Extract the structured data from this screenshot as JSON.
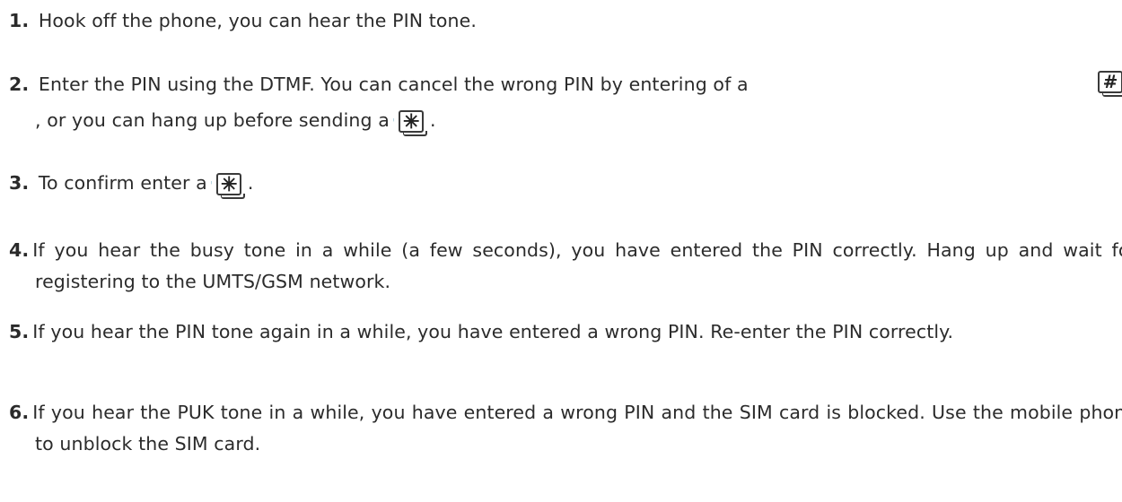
{
  "steps": [
    {
      "num": "1.",
      "text": "Hook off the phone, you can hear the PIN tone."
    },
    {
      "num": "2.",
      "text_a": "Enter the PIN using the DTMF. You can cancel the wrong PIN by entering of a",
      "key_a": "#",
      "text_b": ", or you can hang up before sending a",
      "key_b": "✳",
      "text_c": "."
    },
    {
      "num": "3.",
      "text": "To confirm enter a",
      "key": "✳",
      "text_end": "."
    },
    {
      "num": "4.",
      "text": "If you hear the busy tone in a while (a few seconds), you have entered the PIN correctly. Hang up and wait for registering to the UMTS/GSM network."
    },
    {
      "num": "5.",
      "text": "If you hear the PIN tone again in a while, you have entered a wrong PIN. Re-enter the PIN correctly."
    },
    {
      "num": "6.",
      "text": "If you hear the PUK tone in a while, you have entered a wrong PIN and the SIM card is blocked. Use the mobile phone to unblock the SIM card."
    }
  ],
  "icons": {
    "hash_key": "hash-key-icon",
    "star_key": "star-key-icon"
  }
}
